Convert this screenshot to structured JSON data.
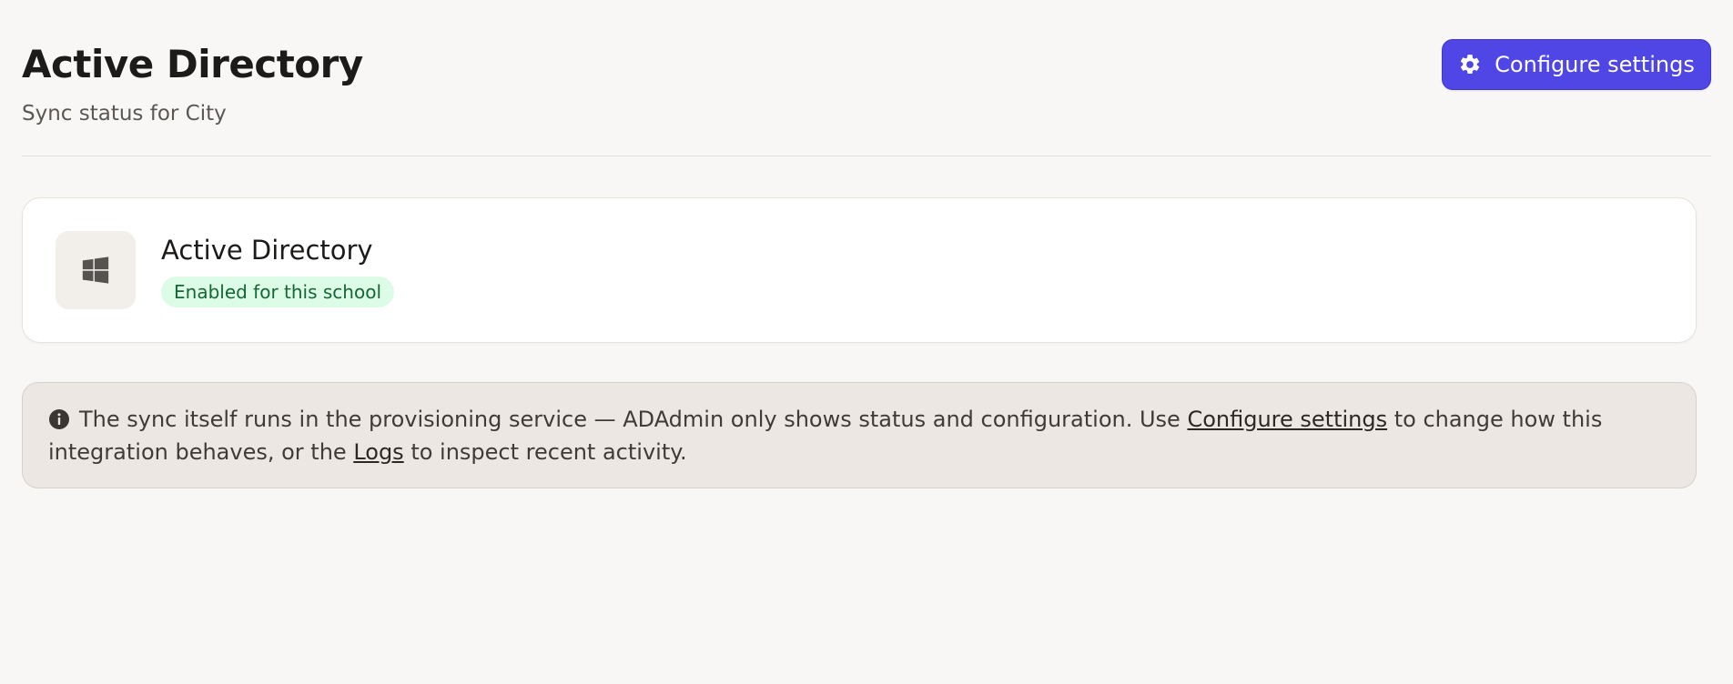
{
  "header": {
    "title": "Active Directory",
    "subtitle": "Sync status for City",
    "configure_button_label": "Configure settings",
    "configure_button_icon": "gear-icon"
  },
  "integration": {
    "logo_icon": "windows-logo-icon",
    "name": "Active Directory",
    "status_badge": "Enabled for this school"
  },
  "info_banner": {
    "icon": "info-icon",
    "text_before": "The sync itself runs in the provisioning service — ADAdmin only shows status and configuration. Use ",
    "link_configure": "Configure settings",
    "text_middle": " to change how this integration behaves, or the ",
    "link_logs": "Logs",
    "text_after": " to inspect recent activity."
  },
  "colors": {
    "accent": "#4f46e5",
    "badge_bg": "#dcfce7",
    "badge_text": "#166534",
    "page_bg": "#f8f7f5",
    "banner_bg": "#ece7e2"
  }
}
